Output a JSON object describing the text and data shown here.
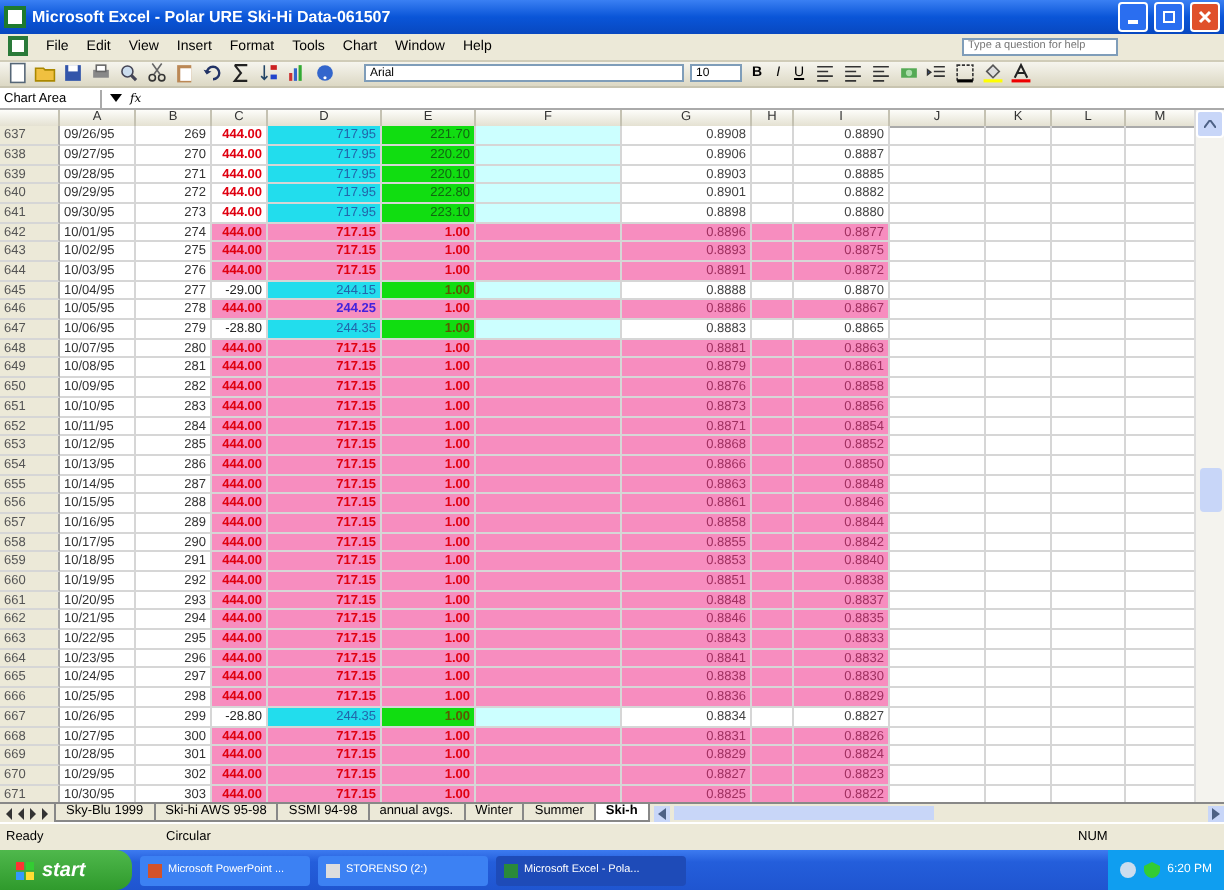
{
  "window": {
    "title": "Microsoft Excel - Polar URE Ski-Hi Data-061507"
  },
  "menu": [
    "File",
    "Edit",
    "View",
    "Insert",
    "Format",
    "Tools",
    "Chart",
    "Window",
    "Help"
  ],
  "help_box": {
    "placeholder": "Type a question for help"
  },
  "format_toolbar": {
    "font": "Arial",
    "size": "10",
    "buttons": [
      "B",
      "I",
      "U"
    ]
  },
  "formula_bar": {
    "name_box": "Chart Area",
    "fx": "fx"
  },
  "sheet": {
    "columns": [
      "A",
      "B",
      "C",
      "D",
      "E",
      "F",
      "G",
      "H",
      "I",
      "J",
      "K",
      "L",
      "M"
    ],
    "rows": [
      {
        "num": "637",
        "date": "09/26/95",
        "b": "269",
        "c": "444.00",
        "d": "717.95",
        "e": "221.70",
        "g": "0.8908",
        "i": "0.8890",
        "kind": "base"
      },
      {
        "num": "638",
        "date": "09/27/95",
        "b": "270",
        "c": "444.00",
        "d": "717.95",
        "e": "220.20",
        "g": "0.8906",
        "i": "0.8887",
        "kind": "base"
      },
      {
        "num": "639",
        "date": "09/28/95",
        "b": "271",
        "c": "444.00",
        "d": "717.95",
        "e": "220.10",
        "g": "0.8903",
        "i": "0.8885",
        "kind": "base"
      },
      {
        "num": "640",
        "date": "09/29/95",
        "b": "272",
        "c": "444.00",
        "d": "717.95",
        "e": "222.80",
        "g": "0.8901",
        "i": "0.8882",
        "kind": "base"
      },
      {
        "num": "641",
        "date": "09/30/95",
        "b": "273",
        "c": "444.00",
        "d": "717.95",
        "e": "223.10",
        "g": "0.8898",
        "i": "0.8880",
        "kind": "base"
      },
      {
        "num": "642",
        "date": "10/01/95",
        "b": "274",
        "c": "444.00",
        "d": "717.15",
        "e": "1.00",
        "g": "0.8896",
        "i": "0.8877",
        "kind": "flagged"
      },
      {
        "num": "643",
        "date": "10/02/95",
        "b": "275",
        "c": "444.00",
        "d": "717.15",
        "e": "1.00",
        "g": "0.8893",
        "i": "0.8875",
        "kind": "flagged"
      },
      {
        "num": "644",
        "date": "10/03/95",
        "b": "276",
        "c": "444.00",
        "d": "717.15",
        "e": "1.00",
        "g": "0.8891",
        "i": "0.8872",
        "kind": "flagged"
      },
      {
        "num": "645",
        "date": "10/04/95",
        "b": "277",
        "c": "-29.00",
        "d": "244.15",
        "e": "1.00",
        "g": "0.8888",
        "i": "0.8870",
        "kind": "adjusted"
      },
      {
        "num": "646",
        "date": "10/05/95",
        "b": "278",
        "c": "444.00",
        "d": "244.25",
        "e": "1.00",
        "g": "0.8886",
        "i": "0.8867",
        "kind": "mixed"
      },
      {
        "num": "647",
        "date": "10/06/95",
        "b": "279",
        "c": "-28.80",
        "d": "244.35",
        "e": "1.00",
        "g": "0.8883",
        "i": "0.8865",
        "kind": "adjusted"
      },
      {
        "num": "648",
        "date": "10/07/95",
        "b": "280",
        "c": "444.00",
        "d": "717.15",
        "e": "1.00",
        "g": "0.8881",
        "i": "0.8863",
        "kind": "flagged"
      },
      {
        "num": "649",
        "date": "10/08/95",
        "b": "281",
        "c": "444.00",
        "d": "717.15",
        "e": "1.00",
        "g": "0.8879",
        "i": "0.8861",
        "kind": "flagged"
      },
      {
        "num": "650",
        "date": "10/09/95",
        "b": "282",
        "c": "444.00",
        "d": "717.15",
        "e": "1.00",
        "g": "0.8876",
        "i": "0.8858",
        "kind": "flagged"
      },
      {
        "num": "651",
        "date": "10/10/95",
        "b": "283",
        "c": "444.00",
        "d": "717.15",
        "e": "1.00",
        "g": "0.8873",
        "i": "0.8856",
        "kind": "flagged"
      },
      {
        "num": "652",
        "date": "10/11/95",
        "b": "284",
        "c": "444.00",
        "d": "717.15",
        "e": "1.00",
        "g": "0.8871",
        "i": "0.8854",
        "kind": "flagged"
      },
      {
        "num": "653",
        "date": "10/12/95",
        "b": "285",
        "c": "444.00",
        "d": "717.15",
        "e": "1.00",
        "g": "0.8868",
        "i": "0.8852",
        "kind": "flagged"
      },
      {
        "num": "654",
        "date": "10/13/95",
        "b": "286",
        "c": "444.00",
        "d": "717.15",
        "e": "1.00",
        "g": "0.8866",
        "i": "0.8850",
        "kind": "flagged"
      },
      {
        "num": "655",
        "date": "10/14/95",
        "b": "287",
        "c": "444.00",
        "d": "717.15",
        "e": "1.00",
        "g": "0.8863",
        "i": "0.8848",
        "kind": "flagged"
      },
      {
        "num": "656",
        "date": "10/15/95",
        "b": "288",
        "c": "444.00",
        "d": "717.15",
        "e": "1.00",
        "g": "0.8861",
        "i": "0.8846",
        "kind": "flagged"
      },
      {
        "num": "657",
        "date": "10/16/95",
        "b": "289",
        "c": "444.00",
        "d": "717.15",
        "e": "1.00",
        "g": "0.8858",
        "i": "0.8844",
        "kind": "flagged"
      },
      {
        "num": "658",
        "date": "10/17/95",
        "b": "290",
        "c": "444.00",
        "d": "717.15",
        "e": "1.00",
        "g": "0.8855",
        "i": "0.8842",
        "kind": "flagged"
      },
      {
        "num": "659",
        "date": "10/18/95",
        "b": "291",
        "c": "444.00",
        "d": "717.15",
        "e": "1.00",
        "g": "0.8853",
        "i": "0.8840",
        "kind": "flagged"
      },
      {
        "num": "660",
        "date": "10/19/95",
        "b": "292",
        "c": "444.00",
        "d": "717.15",
        "e": "1.00",
        "g": "0.8851",
        "i": "0.8838",
        "kind": "flagged"
      },
      {
        "num": "661",
        "date": "10/20/95",
        "b": "293",
        "c": "444.00",
        "d": "717.15",
        "e": "1.00",
        "g": "0.8848",
        "i": "0.8837",
        "kind": "flagged"
      },
      {
        "num": "662",
        "date": "10/21/95",
        "b": "294",
        "c": "444.00",
        "d": "717.15",
        "e": "1.00",
        "g": "0.8846",
        "i": "0.8835",
        "kind": "flagged"
      },
      {
        "num": "663",
        "date": "10/22/95",
        "b": "295",
        "c": "444.00",
        "d": "717.15",
        "e": "1.00",
        "g": "0.8843",
        "i": "0.8833",
        "kind": "flagged"
      },
      {
        "num": "664",
        "date": "10/23/95",
        "b": "296",
        "c": "444.00",
        "d": "717.15",
        "e": "1.00",
        "g": "0.8841",
        "i": "0.8832",
        "kind": "flagged"
      },
      {
        "num": "665",
        "date": "10/24/95",
        "b": "297",
        "c": "444.00",
        "d": "717.15",
        "e": "1.00",
        "g": "0.8838",
        "i": "0.8830",
        "kind": "flagged"
      },
      {
        "num": "666",
        "date": "10/25/95",
        "b": "298",
        "c": "444.00",
        "d": "717.15",
        "e": "1.00",
        "g": "0.8836",
        "i": "0.8829",
        "kind": "flagged"
      },
      {
        "num": "667",
        "date": "10/26/95",
        "b": "299",
        "c": "-28.80",
        "d": "244.35",
        "e": "1.00",
        "g": "0.8834",
        "i": "0.8827",
        "kind": "adjusted"
      },
      {
        "num": "668",
        "date": "10/27/95",
        "b": "300",
        "c": "444.00",
        "d": "717.15",
        "e": "1.00",
        "g": "0.8831",
        "i": "0.8826",
        "kind": "flagged"
      },
      {
        "num": "669",
        "date": "10/28/95",
        "b": "301",
        "c": "444.00",
        "d": "717.15",
        "e": "1.00",
        "g": "0.8829",
        "i": "0.8824",
        "kind": "flagged"
      },
      {
        "num": "670",
        "date": "10/29/95",
        "b": "302",
        "c": "444.00",
        "d": "717.15",
        "e": "1.00",
        "g": "0.8827",
        "i": "0.8823",
        "kind": "flagged"
      },
      {
        "num": "671",
        "date": "10/30/95",
        "b": "303",
        "c": "444.00",
        "d": "717.15",
        "e": "1.00",
        "g": "0.8825",
        "i": "0.8822",
        "kind": "flagged"
      }
    ]
  },
  "sheet_tabs": [
    {
      "label": "Sky-Blu 1999",
      "selected": false
    },
    {
      "label": "Ski-hi AWS 95-98",
      "selected": false
    },
    {
      "label": "SSMI 94-98",
      "selected": false
    },
    {
      "label": "annual avgs.",
      "selected": false
    },
    {
      "label": "Winter",
      "selected": false
    },
    {
      "label": "Summer",
      "selected": false
    },
    {
      "label": "Ski-h",
      "selected": true
    }
  ],
  "status_bar": {
    "mode": "Ready",
    "message": "Circular",
    "num": "NUM"
  },
  "taskbar": {
    "start": "start",
    "buttons": [
      {
        "label": "Microsoft PowerPoint ...",
        "selected": false
      },
      {
        "label": "STORENSO (2:)",
        "selected": false
      },
      {
        "label": "Microsoft Excel - Pola...",
        "selected": true
      }
    ],
    "clock": "6:20 PM"
  }
}
